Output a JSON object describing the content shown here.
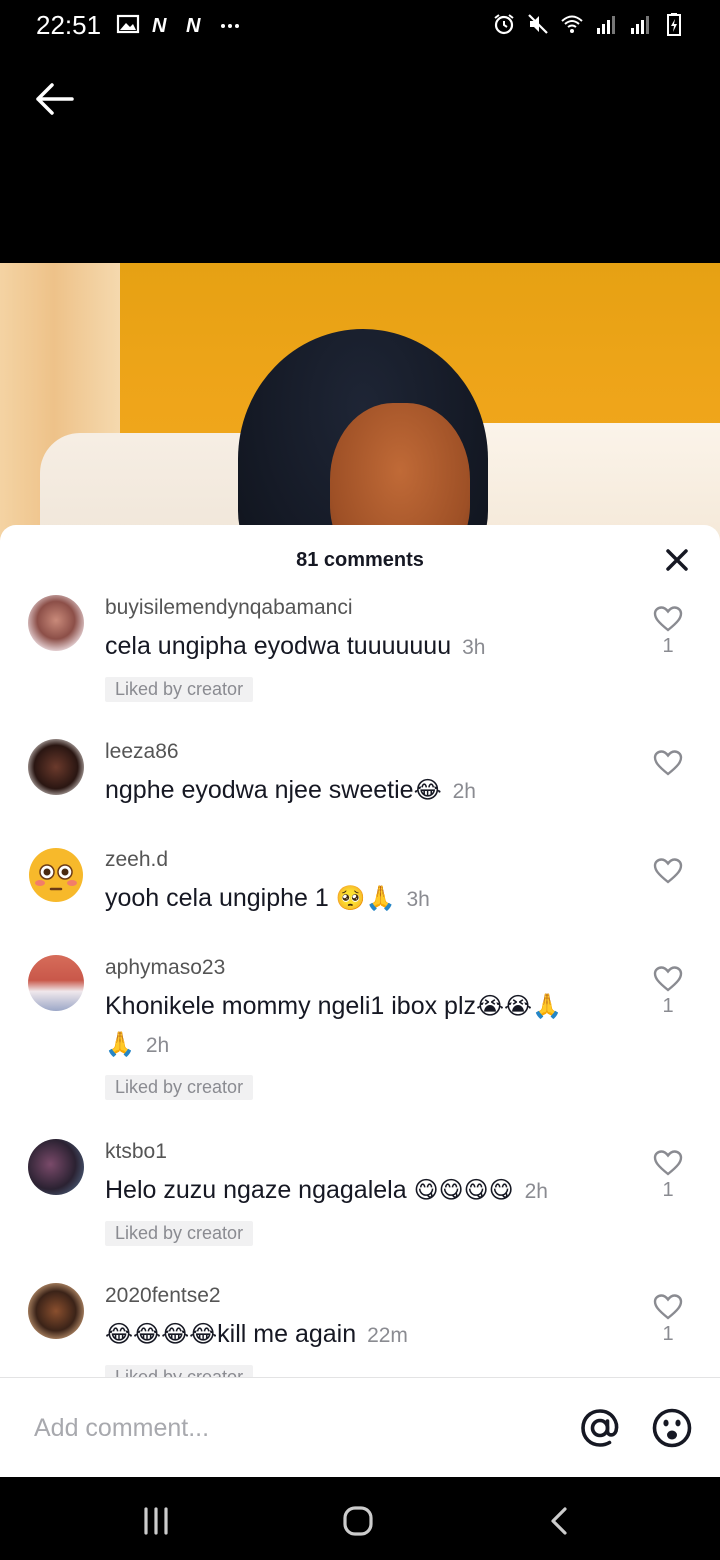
{
  "status_bar": {
    "time": "22:51",
    "left_icons": [
      "gallery-icon",
      "n-icon",
      "n-icon",
      "more-dots-icon"
    ],
    "right_icons": [
      "alarm-icon",
      "mute-icon",
      "wifi-icon",
      "signal-icon",
      "signal-icon",
      "battery-icon"
    ]
  },
  "comments_panel": {
    "count_label": "81 comments",
    "comments": [
      {
        "username": "buyisilemendynqabamanci",
        "text": "cela ungipha eyodwa tuuuuuuu",
        "time": "3h",
        "liked_by_creator": "Liked by creator",
        "likes": "1"
      },
      {
        "username": "leeza86",
        "text": "ngphe eyodwa njee sweetie",
        "emojis": "😂",
        "time": "2h",
        "liked_by_creator": "",
        "likes": ""
      },
      {
        "username": "zeeh.d",
        "text": "yooh cela ungiphe 1 ",
        "emojis": "🥺🙏",
        "time": "3h",
        "liked_by_creator": "",
        "likes": ""
      },
      {
        "username": "aphymaso23",
        "text": "Khonikele mommy ngeli1 ibox plz",
        "emojis": "😭😭🙏",
        "line2_emojis": "🙏",
        "time": "2h",
        "liked_by_creator": "Liked by creator",
        "likes": "1"
      },
      {
        "username": "ktsbo1",
        "text": "Helo zuzu ngaze ngagalela ",
        "emojis": "😋😋😋😋",
        "time": "2h",
        "liked_by_creator": "Liked by creator",
        "likes": "1"
      },
      {
        "username": "2020fentse2",
        "emojis": "😂😂😂😂",
        "text": "kill me again",
        "time": "22m",
        "liked_by_creator": "Liked by creator",
        "likes": "1"
      }
    ]
  },
  "input": {
    "placeholder": "Add comment..."
  },
  "colors": {
    "accent_text": "#161823",
    "muted": "#8a8b91",
    "video_orange": "#efa51a"
  }
}
